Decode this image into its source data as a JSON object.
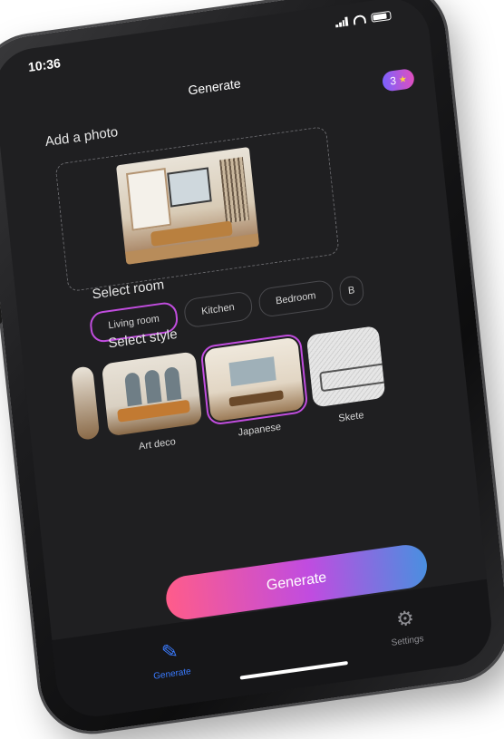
{
  "status": {
    "time": "10:36"
  },
  "header": {
    "title": "Generate",
    "credits": "3"
  },
  "upload": {
    "label": "Add a photo"
  },
  "room": {
    "label": "Select room",
    "options": [
      "Living room",
      "Kitchen",
      "Bedroom",
      "B"
    ],
    "selected": "Living room"
  },
  "style": {
    "label": "Select style",
    "options": [
      "Art deco",
      "Japanese",
      "Skete"
    ],
    "selected": "Japanese"
  },
  "generate_button": {
    "label": "Generate"
  },
  "tabbar": {
    "items": [
      {
        "label": "Generate",
        "icon": "brush-icon"
      },
      {
        "label": "Settings",
        "icon": "gear-icon"
      }
    ]
  },
  "colors": {
    "accent_purple": "#c14ddf",
    "active_tab": "#3a7bff",
    "button_gradient": [
      "#ff5c8a",
      "#c04ce0",
      "#4a8fe0"
    ]
  }
}
